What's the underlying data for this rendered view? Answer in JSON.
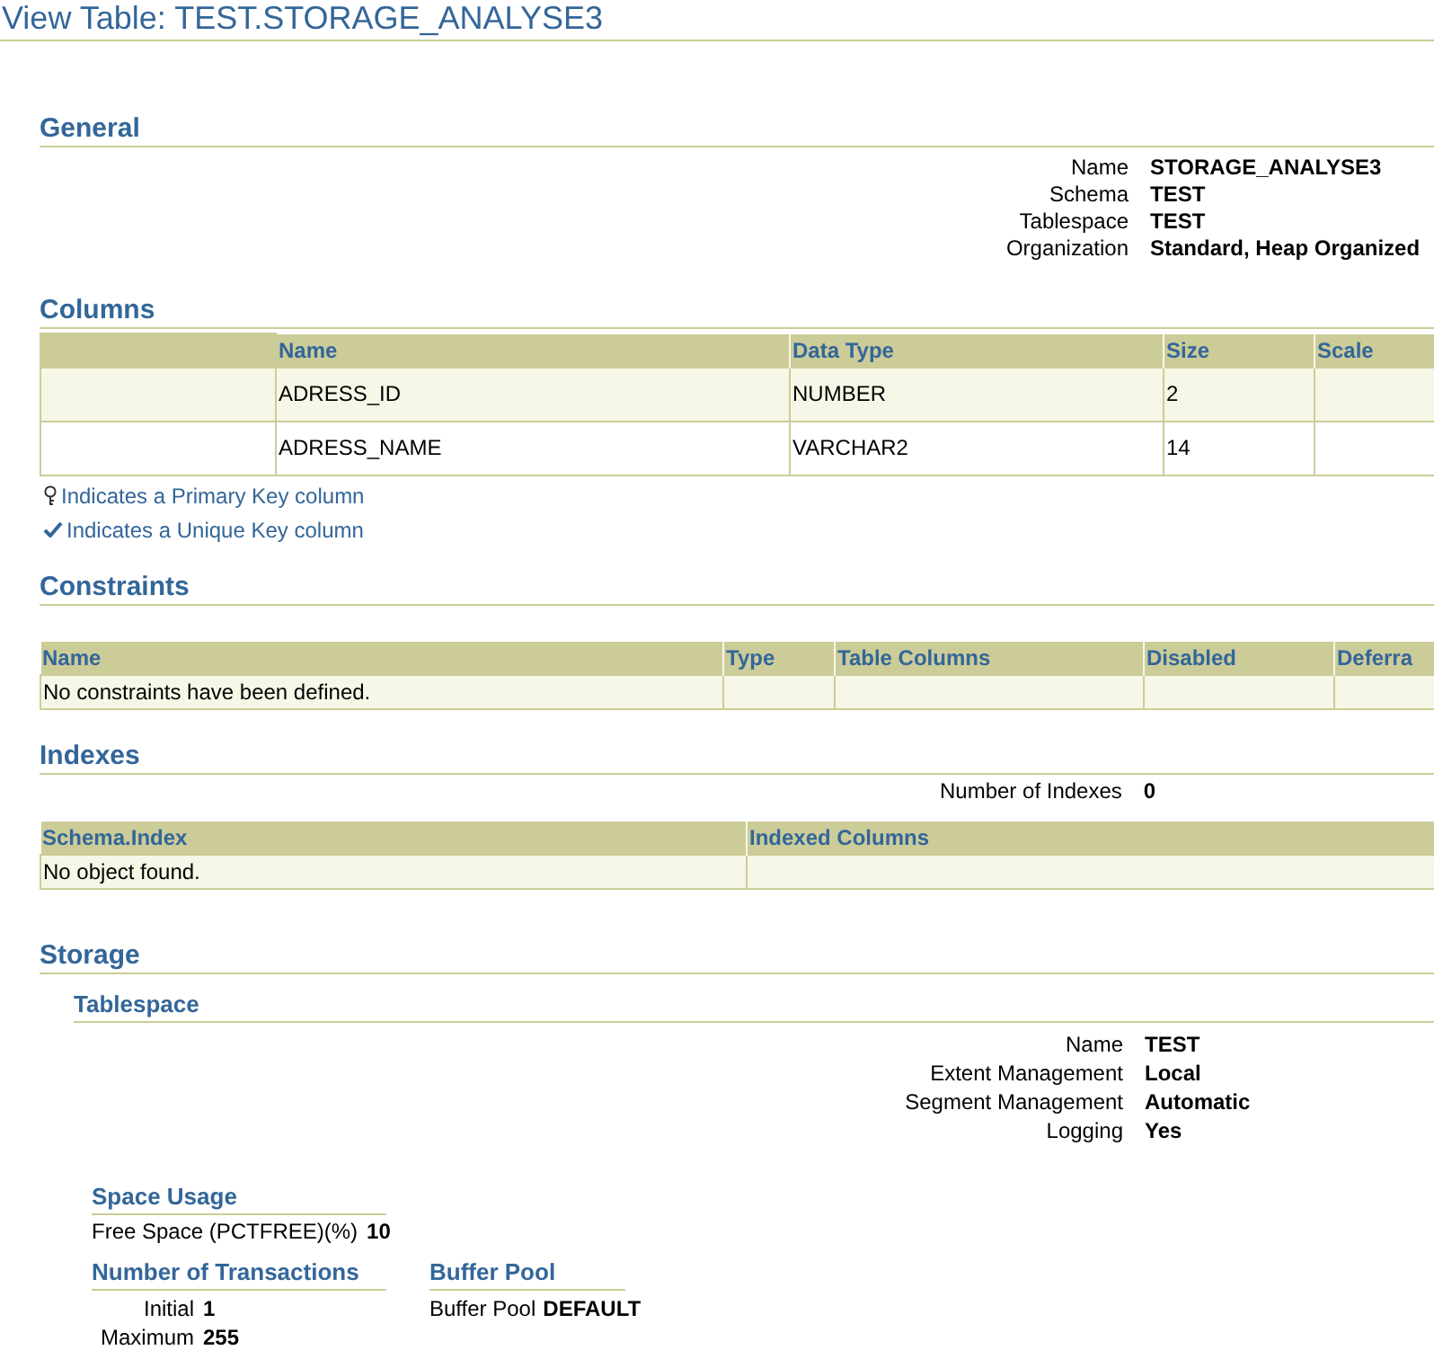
{
  "title": "View Table: TEST.STORAGE_ANALYSE3",
  "general": {
    "heading": "General",
    "fields": [
      {
        "label": "Name",
        "value": "STORAGE_ANALYSE3"
      },
      {
        "label": "Schema",
        "value": "TEST"
      },
      {
        "label": "Tablespace",
        "value": "TEST"
      },
      {
        "label": "Organization",
        "value": "Standard, Heap Organized"
      }
    ]
  },
  "columns": {
    "heading": "Columns",
    "table_columns": [
      "Name",
      "Data Type",
      "Size",
      "Scale"
    ],
    "rows": [
      {
        "name": "ADRESS_ID",
        "data_type": "NUMBER",
        "size": "2"
      },
      {
        "name": "ADRESS_NAME",
        "data_type": "VARCHAR2",
        "size": "14"
      }
    ],
    "legend": [
      {
        "kind": "primary",
        "text": "Indicates a Primary Key column"
      },
      {
        "kind": "unique",
        "text": "Indicates a Unique Key column"
      }
    ]
  },
  "constraints": {
    "heading": "Constraints",
    "table_columns": [
      "Name",
      "Type",
      "Table Columns",
      "Disabled",
      "Deferra"
    ],
    "empty_message": "No constraints have been defined."
  },
  "indexes": {
    "heading": "Indexes",
    "count_label": "Number of Indexes",
    "count": "0",
    "table_columns": [
      "Schema.Index",
      "Indexed Columns"
    ],
    "empty_message": "No object found."
  },
  "storage": {
    "heading": "Storage",
    "tablespace": {
      "heading": "Tablespace",
      "fields": [
        {
          "label": "Name",
          "value": "TEST"
        },
        {
          "label": "Extent Management",
          "value": "Local"
        },
        {
          "label": "Segment Management",
          "value": "Automatic"
        },
        {
          "label": "Logging",
          "value": "Yes"
        }
      ]
    },
    "space_usage": {
      "heading": "Space Usage",
      "label": "Free Space (PCTFREE)(%)",
      "value": "10"
    },
    "transactions": {
      "heading": "Number of Transactions",
      "fields": [
        {
          "label": "Initial",
          "value": "1"
        },
        {
          "label": "Maximum",
          "value": "255"
        }
      ]
    },
    "buffer_pool": {
      "heading": "Buffer Pool",
      "label": "Buffer Pool",
      "value": "DEFAULT"
    }
  }
}
